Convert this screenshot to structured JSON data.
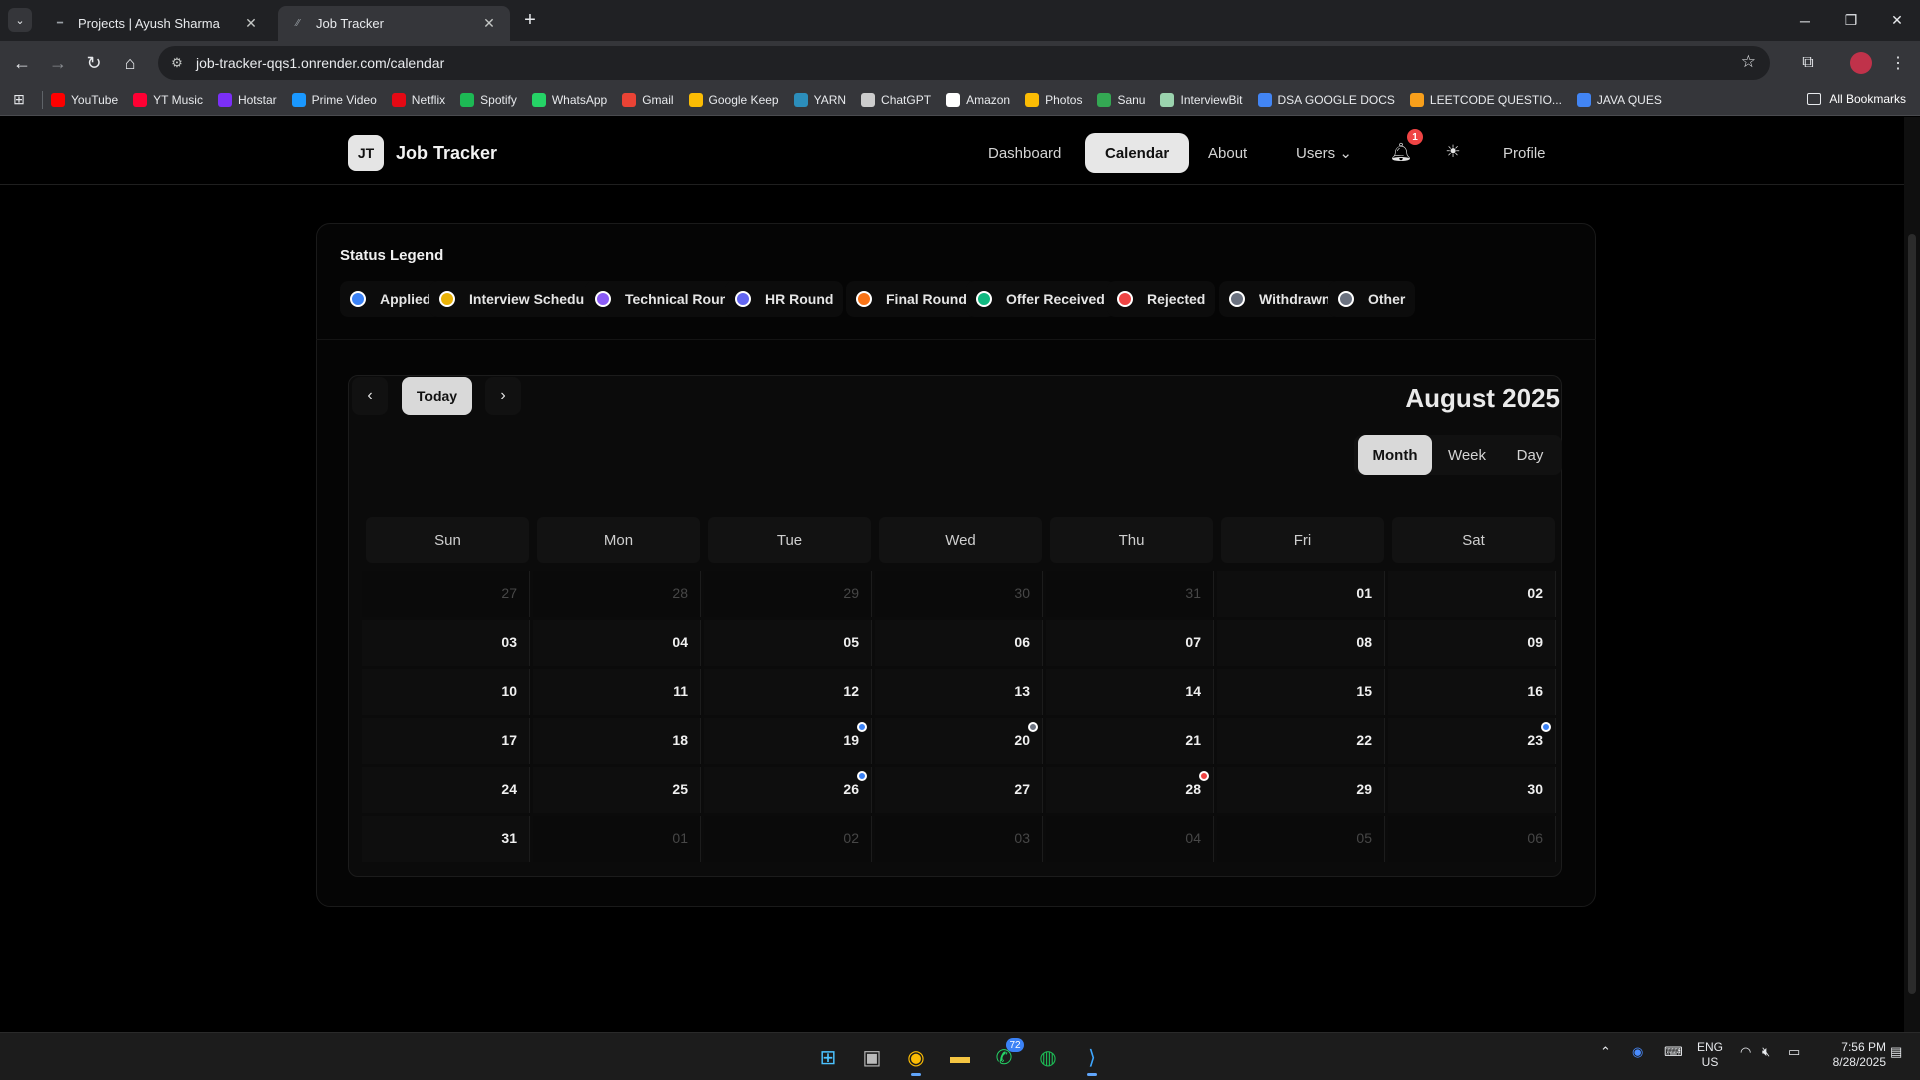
{
  "browser": {
    "tabs": [
      {
        "title": "Projects | Ayush Sharma",
        "active": false
      },
      {
        "title": "Job Tracker",
        "active": true
      }
    ],
    "url": "job-tracker-qqs1.onrender.com/calendar",
    "bookmarks": [
      {
        "label": "YouTube",
        "color": "#ff0000"
      },
      {
        "label": "YT Music",
        "color": "#ff0033"
      },
      {
        "label": "Hotstar",
        "color": "#7b2ff7"
      },
      {
        "label": "Prime Video",
        "color": "#1a98ff"
      },
      {
        "label": "Netflix",
        "color": "#e50914"
      },
      {
        "label": "Spotify",
        "color": "#1db954"
      },
      {
        "label": "WhatsApp",
        "color": "#25d366"
      },
      {
        "label": "Gmail",
        "color": "#ea4335"
      },
      {
        "label": "Google Keep",
        "color": "#fbbc04"
      },
      {
        "label": "YARN",
        "color": "#2c8ebb"
      },
      {
        "label": "ChatGPT",
        "color": "#cccccc"
      },
      {
        "label": "Amazon",
        "color": "#ffffff"
      },
      {
        "label": "Photos",
        "color": "#fbbc04"
      },
      {
        "label": "Sanu",
        "color": "#34a853"
      },
      {
        "label": "InterviewBit",
        "color": "#9bd3ae"
      },
      {
        "label": "DSA GOOGLE DOCS",
        "color": "#4285f4"
      },
      {
        "label": "LEETCODE QUESTIO...",
        "color": "#f89f1b"
      },
      {
        "label": "JAVA QUES",
        "color": "#4285f4"
      }
    ],
    "all_bookmarks": "All Bookmarks"
  },
  "app": {
    "brand_badge": "JT",
    "brand_name": "Job Tracker",
    "nav": [
      {
        "label": "Dashboard",
        "active": false
      },
      {
        "label": "Calendar",
        "active": true
      },
      {
        "label": "About",
        "active": false
      },
      {
        "label": "Users ⌄",
        "active": false
      },
      {
        "label": "Profile",
        "active": false
      }
    ],
    "notification_count": "1"
  },
  "legend": {
    "title": "Status Legend",
    "items": [
      {
        "label": "Applied",
        "color": "#3b82f6"
      },
      {
        "label": "Interview Scheduled",
        "color": "#eab308"
      },
      {
        "label": "Technical Round",
        "color": "#8b5cf6"
      },
      {
        "label": "HR Round",
        "color": "#6366f1"
      },
      {
        "label": "Final Round",
        "color": "#f97316"
      },
      {
        "label": "Offer Received",
        "color": "#10b981"
      },
      {
        "label": "Rejected",
        "color": "#ef4444"
      },
      {
        "label": "Withdrawn",
        "color": "#6b7280"
      },
      {
        "label": "Other",
        "color": "#6b7280"
      }
    ]
  },
  "calendar": {
    "today_label": "Today",
    "month_title": "August 2025",
    "views": [
      {
        "label": "Month",
        "active": true
      },
      {
        "label": "Week",
        "active": false
      },
      {
        "label": "Day",
        "active": false
      }
    ],
    "days_of_week": [
      "Sun",
      "Mon",
      "Tue",
      "Wed",
      "Thu",
      "Fri",
      "Sat"
    ],
    "weeks": [
      [
        {
          "d": "27",
          "other": true
        },
        {
          "d": "28",
          "other": true
        },
        {
          "d": "29",
          "other": true
        },
        {
          "d": "30",
          "other": true
        },
        {
          "d": "31",
          "other": true
        },
        {
          "d": "01"
        },
        {
          "d": "02"
        }
      ],
      [
        {
          "d": "03"
        },
        {
          "d": "04"
        },
        {
          "d": "05"
        },
        {
          "d": "06"
        },
        {
          "d": "07"
        },
        {
          "d": "08"
        },
        {
          "d": "09"
        }
      ],
      [
        {
          "d": "10"
        },
        {
          "d": "11"
        },
        {
          "d": "12"
        },
        {
          "d": "13"
        },
        {
          "d": "14"
        },
        {
          "d": "15"
        },
        {
          "d": "16"
        }
      ],
      [
        {
          "d": "17"
        },
        {
          "d": "18"
        },
        {
          "d": "19",
          "event": "#3b82f6"
        },
        {
          "d": "20",
          "event": "#6b7280"
        },
        {
          "d": "21"
        },
        {
          "d": "22"
        },
        {
          "d": "23",
          "event": "#3b82f6"
        }
      ],
      [
        {
          "d": "24"
        },
        {
          "d": "25"
        },
        {
          "d": "26",
          "event": "#3b82f6"
        },
        {
          "d": "27"
        },
        {
          "d": "28",
          "event": "#ef4444"
        },
        {
          "d": "29"
        },
        {
          "d": "30"
        }
      ],
      [
        {
          "d": "31"
        },
        {
          "d": "01",
          "other": true
        },
        {
          "d": "02",
          "other": true
        },
        {
          "d": "03",
          "other": true
        },
        {
          "d": "04",
          "other": true
        },
        {
          "d": "05",
          "other": true
        },
        {
          "d": "06",
          "other": true
        }
      ]
    ]
  },
  "taskbar": {
    "whatsapp_badge": "72",
    "lang_top": "ENG",
    "lang_bottom": "US",
    "time": "7:56 PM",
    "date": "8/28/2025"
  }
}
